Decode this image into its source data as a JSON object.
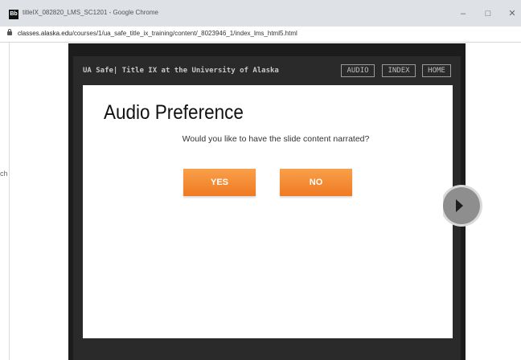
{
  "window": {
    "app_icon_label": "Bb",
    "title": "titleIX_082820_LMS_SC1201 - Google Chrome",
    "minimize_glyph": "–",
    "maximize_glyph": "□",
    "close_glyph": "✕"
  },
  "address": {
    "host": "classes.alaska.edu",
    "path": "/courses/1/ua_safe_title_ix_training/content/_8023946_1/index_lms_html5.html"
  },
  "page": {
    "left_sliver_text": "ch"
  },
  "player": {
    "course_title": "UA Safe| Title IX at the University of Alaska",
    "nav": {
      "audio": "AUDIO",
      "index": "INDEX",
      "home": "HOME"
    }
  },
  "slide": {
    "heading": "Audio Preference",
    "question": "Would you like to have the slide content narrated?",
    "yes_label": "YES",
    "no_label": "NO"
  },
  "colors": {
    "accent": "#f58a2e",
    "player_bg": "#1c1c1c",
    "chrome_bg": "#dee1e6"
  },
  "icons": [
    "lock-icon",
    "next-arrow-icon"
  ]
}
